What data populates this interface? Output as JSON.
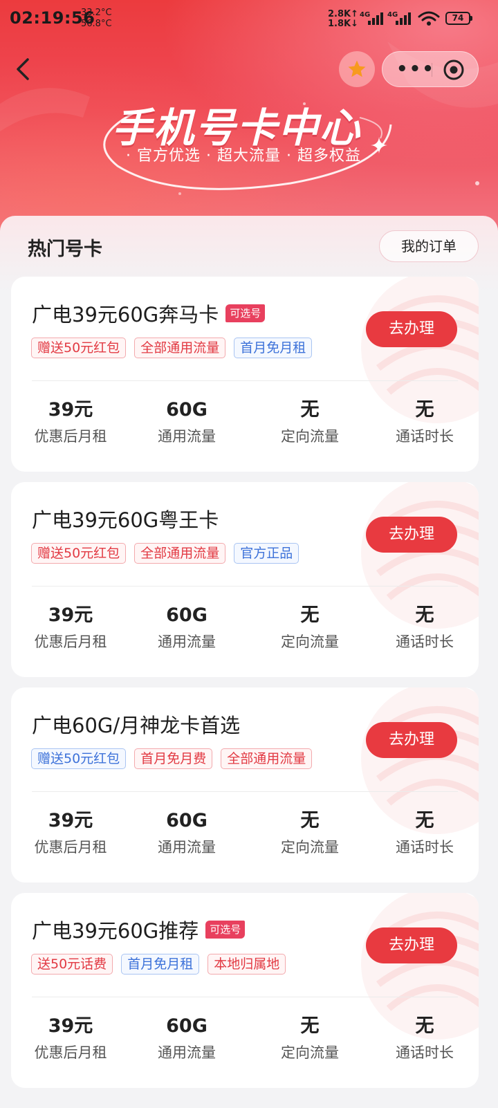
{
  "status_bar": {
    "time": "02:19:56",
    "temp_top": "33.2°C",
    "temp_bottom": "56.8°C",
    "speed_up": "2.8K↑",
    "speed_down": "1.8K↓",
    "net1": "4G",
    "net2": "4G",
    "battery": "74"
  },
  "nav": {
    "back_icon": "chevron-left-icon",
    "favorite_icon": "star-icon",
    "more_icon": "more-dots-icon",
    "close_icon": "target-circle-icon"
  },
  "banner": {
    "title": "手机号卡中心",
    "subtitle": "· 官方优选 · 超大流量 · 超多权益"
  },
  "section": {
    "title": "热门号卡",
    "orders_label": "我的订单"
  },
  "colors": {
    "brand_red": "#e83a40",
    "tag_red": "#e23a43",
    "tag_blue": "#3d72d9",
    "badge": "#e8405e"
  },
  "cards": [
    {
      "title": "广电39元60G奔马卡",
      "badge": "可选号",
      "tags": [
        {
          "text": "赠送50元红包",
          "color": "red"
        },
        {
          "text": "全部通用流量",
          "color": "red"
        },
        {
          "text": "首月免月租",
          "color": "blue"
        }
      ],
      "button": "去办理",
      "stats": [
        {
          "value": "39元",
          "label": "优惠后月租"
        },
        {
          "value": "60G",
          "label": "通用流量"
        },
        {
          "value": "无",
          "label": "定向流量"
        },
        {
          "value": "无",
          "label": "通话时长"
        }
      ]
    },
    {
      "title": "广电39元60G粤王卡",
      "badge": "",
      "tags": [
        {
          "text": "赠送50元红包",
          "color": "red"
        },
        {
          "text": "全部通用流量",
          "color": "red"
        },
        {
          "text": "官方正品",
          "color": "blue"
        }
      ],
      "button": "去办理",
      "stats": [
        {
          "value": "39元",
          "label": "优惠后月租"
        },
        {
          "value": "60G",
          "label": "通用流量"
        },
        {
          "value": "无",
          "label": "定向流量"
        },
        {
          "value": "无",
          "label": "通话时长"
        }
      ]
    },
    {
      "title": "广电60G/月神龙卡首选",
      "badge": "",
      "tags": [
        {
          "text": "赠送50元红包",
          "color": "blue"
        },
        {
          "text": "首月免月费",
          "color": "red"
        },
        {
          "text": "全部通用流量",
          "color": "red"
        }
      ],
      "button": "去办理",
      "stats": [
        {
          "value": "39元",
          "label": "优惠后月租"
        },
        {
          "value": "60G",
          "label": "通用流量"
        },
        {
          "value": "无",
          "label": "定向流量"
        },
        {
          "value": "无",
          "label": "通话时长"
        }
      ]
    },
    {
      "title": "广电39元60G推荐",
      "badge": "可选号",
      "tags": [
        {
          "text": "送50元话费",
          "color": "red"
        },
        {
          "text": "首月免月租",
          "color": "blue"
        },
        {
          "text": "本地归属地",
          "color": "red"
        }
      ],
      "button": "去办理",
      "stats": [
        {
          "value": "39元",
          "label": "优惠后月租"
        },
        {
          "value": "60G",
          "label": "通用流量"
        },
        {
          "value": "无",
          "label": "定向流量"
        },
        {
          "value": "无",
          "label": "通话时长"
        }
      ]
    }
  ]
}
